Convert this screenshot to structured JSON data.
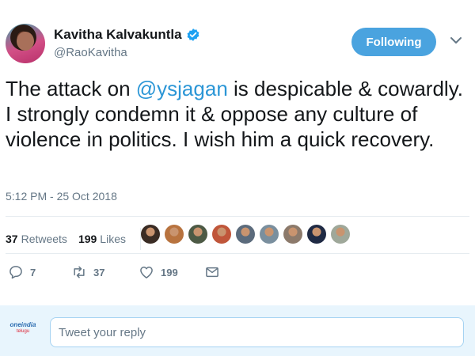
{
  "author": {
    "display_name": "Kavitha Kalvakuntla",
    "handle": "@RaoKavitha",
    "verified": true
  },
  "follow_button": {
    "label": "Following",
    "color": "#4aa3df"
  },
  "tweet": {
    "text_before": "The attack on ",
    "mention": "@ysjagan",
    "text_after": " is despicable & cowardly. I strongly condemn it & oppose any culture of violence in politics. I wish him a quick recovery.",
    "timestamp": "5:12 PM - 25 Oct 2018"
  },
  "stats": {
    "retweets_count": "37",
    "retweets_label": "Retweets",
    "likes_count": "199",
    "likes_label": "Likes"
  },
  "likers": [
    {
      "name": "liker-avatar-1",
      "color": "#3a2c24"
    },
    {
      "name": "liker-avatar-2",
      "color": "#b8733f"
    },
    {
      "name": "liker-avatar-3",
      "color": "#4d5a45"
    },
    {
      "name": "liker-avatar-4",
      "color": "#c0563a"
    },
    {
      "name": "liker-avatar-5",
      "color": "#5b6b7c"
    },
    {
      "name": "liker-avatar-6",
      "color": "#7a8f9e"
    },
    {
      "name": "liker-avatar-7",
      "color": "#8c7a6b"
    },
    {
      "name": "liker-avatar-8",
      "color": "#1f2a44"
    },
    {
      "name": "liker-avatar-9",
      "color": "#9fa89a"
    }
  ],
  "actions": {
    "reply_count": "7",
    "retweet_count": "37",
    "like_count": "199"
  },
  "reply_box": {
    "placeholder": "Tweet your reply",
    "logo_text": "oneindia",
    "logo_sub": "telugu"
  },
  "colors": {
    "accent": "#1da1f2",
    "mention": "#2b96d6",
    "muted": "#657786"
  }
}
